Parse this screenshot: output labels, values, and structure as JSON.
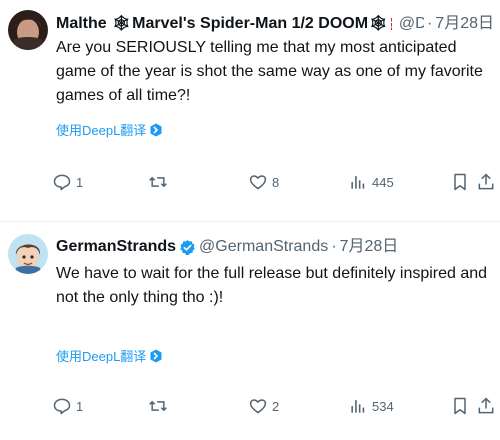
{
  "tweets": [
    {
      "author": {
        "name_part1": "Malthe ",
        "name_part2": "Marvel's Spider-Man 1/2 DOOM",
        "handle": "@DahlMalthe",
        "date": "7月28日"
      },
      "text": "Are you SERIOUSLY telling me that my most anticipated game of the year is shot the same way as one of my favorite games of all time?!",
      "translate_label": "使用DeepL翻译",
      "actions": {
        "reply_count": "1",
        "retweet_count": "",
        "like_count": "8",
        "view_count": "445"
      }
    },
    {
      "author": {
        "name": "GermanStrands",
        "handle": "@GermanStrands",
        "date": "7月28日"
      },
      "text": "We have to wait for the full release but definitely inspired and not the only thing tho :)!",
      "translate_label": "使用DeepL翻译",
      "actions": {
        "reply_count": "1",
        "retweet_count": "",
        "like_count": "2",
        "view_count": "534"
      }
    }
  ],
  "separator": "·",
  "colors": {
    "text": "#0f1419",
    "secondary": "#536471",
    "accent": "#1d9bf0",
    "divider": "#eff3f4"
  },
  "icons": [
    "reply-icon",
    "retweet-icon",
    "like-icon",
    "views-icon",
    "bookmark-icon",
    "share-icon",
    "verified-badge-icon",
    "translate-icon"
  ]
}
